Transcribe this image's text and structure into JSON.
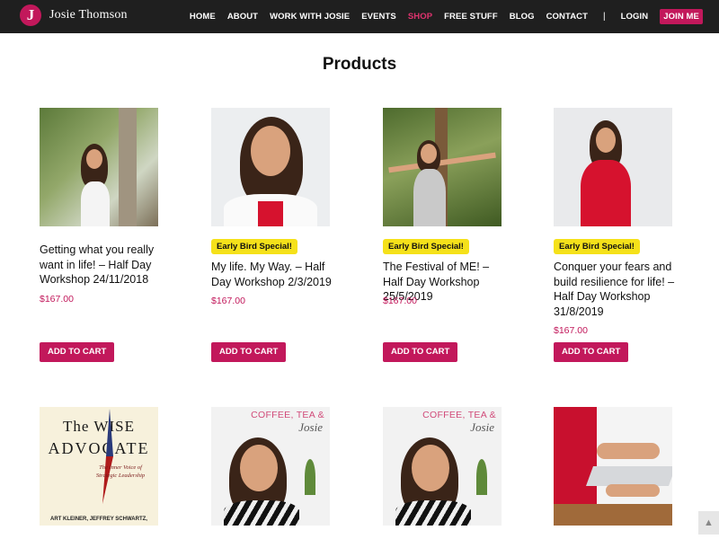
{
  "header": {
    "logo_letter": "J",
    "brand": "Josie Thomson",
    "nav": [
      {
        "label": "HOME"
      },
      {
        "label": "ABOUT"
      },
      {
        "label": "WORK WITH JOSIE"
      },
      {
        "label": "EVENTS"
      },
      {
        "label": "SHOP",
        "active": true
      },
      {
        "label": "FREE STUFF"
      },
      {
        "label": "BLOG"
      },
      {
        "label": "CONTACT"
      }
    ],
    "separator": "|",
    "login": "LOGIN",
    "join": "JOIN ME"
  },
  "page": {
    "title": "Products"
  },
  "products": [
    {
      "name": "Getting what you really want in life! – Half Day Workshop 24/11/2018",
      "price": "$167.00",
      "badge": "",
      "cta": "ADD TO CART",
      "thumb": "garden-portrait"
    },
    {
      "name": "My life. My Way. – Half Day Workshop 2/3/2019",
      "price": "$167.00",
      "badge": "Early Bird Special!",
      "cta": "ADD TO CART",
      "thumb": "white-jacket-portrait"
    },
    {
      "name": "The Festival of ME! – Half Day Workshop 25/5/2019",
      "price": "$167.00",
      "badge": "Early Bird Special!",
      "cta": "ADD TO CART",
      "thumb": "arms-open-portrait"
    },
    {
      "name": "Conquer your fears and build resilience for life! – Half Day Workshop 31/8/2019",
      "price": "$167.00",
      "badge": "Early Bird Special!",
      "cta": "ADD TO CART",
      "thumb": "red-dress-portrait"
    }
  ],
  "row2": {
    "book": {
      "title_line1": "The WISE",
      "title_line2": "ADVOCATE",
      "subtitle": "The Inner Voice of Strategic Leadership",
      "authors": "ART KLEINER, JEFFREY SCHWARTZ,"
    },
    "coffee": {
      "title": "COFFEE, TEA &",
      "name": "Josie"
    }
  },
  "colors": {
    "accent": "#c2185b",
    "badge": "#f5e11a",
    "header_bg": "#1f1f1f"
  },
  "scroll_top_icon": "chevron-up-icon"
}
